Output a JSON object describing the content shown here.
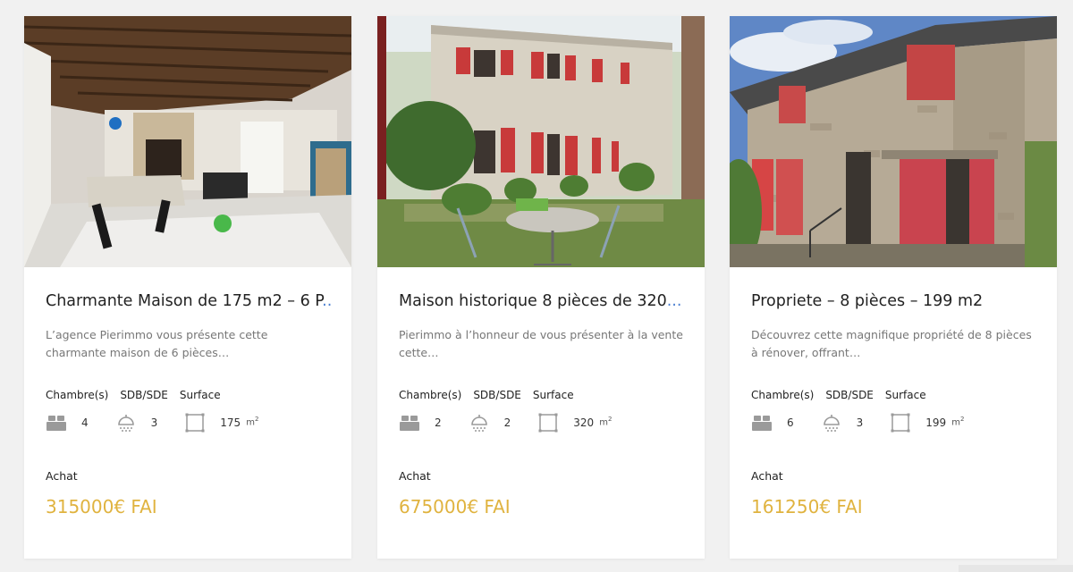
{
  "listings": [
    {
      "title": "Charmante Maison de 175 m2 – 6 P",
      "ellipsis": "...",
      "description": "L’agence Pierimmo vous présente cette charmante maison de 6 pièces…",
      "labels": {
        "bedrooms": "Chambre(s)",
        "bathrooms": "SDB/SDE",
        "surface": "Surface"
      },
      "bedrooms": "4",
      "bathrooms": "3",
      "surface": "175",
      "surface_unit": "m",
      "surface_unit_sup": "2",
      "transaction": "Achat",
      "price": "315000€ FAI",
      "image": "interior-living-room-photo"
    },
    {
      "title": "Maison historique 8 pièces de 320",
      "ellipsis": "...",
      "description": "Pierimmo à l’honneur de vous présenter à la vente cette…",
      "labels": {
        "bedrooms": "Chambre(s)",
        "bathrooms": "SDB/SDE",
        "surface": "Surface"
      },
      "bedrooms": "2",
      "bathrooms": "2",
      "surface": "320",
      "surface_unit": "m",
      "surface_unit_sup": "2",
      "transaction": "Achat",
      "price": "675000€ FAI",
      "image": "stone-house-red-shutters-garden-photo"
    },
    {
      "title": "Propriete – 8 pièces – 199 m2",
      "ellipsis": "",
      "description": "Découvrez cette magnifique propriété de 8 pièces à rénover, offrant…",
      "labels": {
        "bedrooms": "Chambre(s)",
        "bathrooms": "SDB/SDE",
        "surface": "Surface"
      },
      "bedrooms": "6",
      "bathrooms": "3",
      "surface": "199",
      "surface_unit": "m",
      "surface_unit_sup": "2",
      "transaction": "Achat",
      "price": "161250€ FAI",
      "image": "old-stone-barn-red-doors-photo"
    }
  ],
  "colors": {
    "price": "#e0b33f",
    "ellipsis": "#4a7fd1",
    "icon": "#9a9a9a",
    "background": "#f1f1f1"
  }
}
